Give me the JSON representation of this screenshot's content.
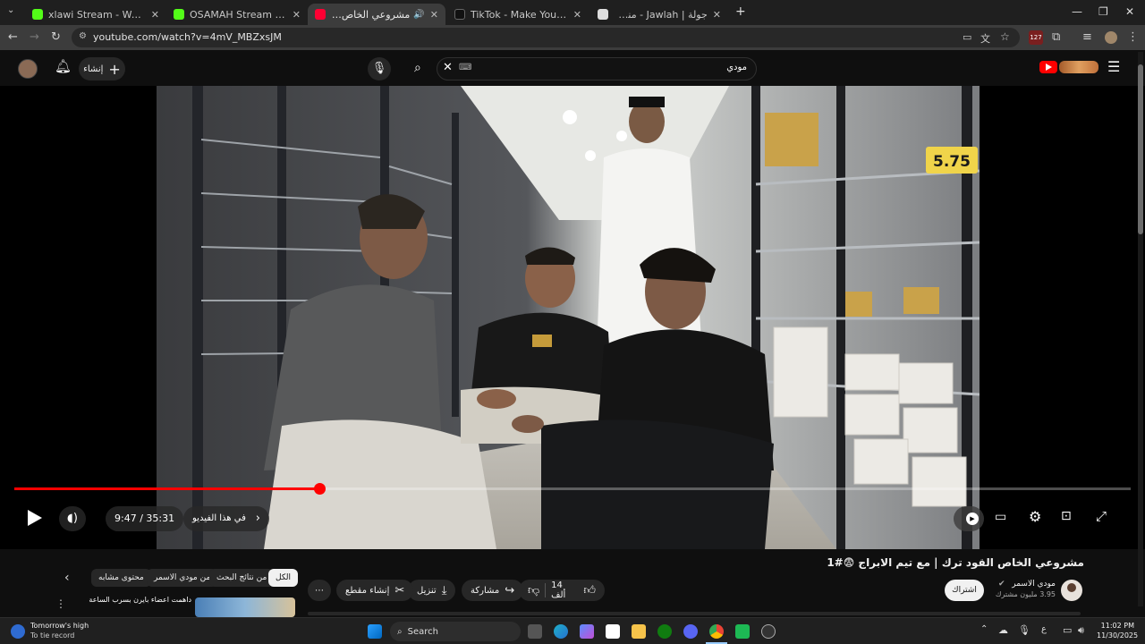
{
  "browser": {
    "tabs": [
      {
        "title": "xlawi Stream - Watch Live on K",
        "favicon": "kick-icon",
        "color": "#53fc18"
      },
      {
        "title": "OSAMAH Stream - Watch Live",
        "favicon": "kick-icon",
        "color": "#53fc18"
      },
      {
        "title": "مشروعي الخاص القود ترك |",
        "favicon": "youtube-icon",
        "color": "#ff0033",
        "active": true
      },
      {
        "title": "TikTok - Make Your Day",
        "favicon": "tiktok-icon",
        "color": "#ffffff"
      },
      {
        "title": "جولة | Jawlah - منصة الألعاب الـ",
        "favicon": "jawlah-icon",
        "color": "#dddddd"
      }
    ],
    "url": "youtube.com/watch?v=4mV_MBZxsJM",
    "extension_badge": "127"
  },
  "yt": {
    "create_label": "إنشاء",
    "search_value": "مودي",
    "search_kbd": "⌨"
  },
  "player": {
    "time": "9:47 / 35:31",
    "chapter": "في هذا الفيديو",
    "progress": 0.273,
    "price_sign": "5.75"
  },
  "video": {
    "title": "مشروعي الخاص القود ترك | مع تيم الابراج 😨#1",
    "channel": "مودي الاسمر",
    "subs": "3.95 مليون مشترك",
    "subscribe_label": "اشتراك",
    "likes": "14 ألف",
    "share_label": "مشاركة",
    "download_label": "تنزيل",
    "clip_label": "إنشاء مقطع"
  },
  "chips": [
    "الكل",
    "من نتائج البحث",
    "من مودي الاسمر",
    "محتوى مشابه"
  ],
  "related": {
    "title": "داهمت اعضاء بايرن بسرب الساعة !!",
    "channel": "Ibrahim L..."
  },
  "taskbar": {
    "notif_title": "Tomorrow's high",
    "notif_sub": "To tie record",
    "search_label": "Search",
    "lang": "ع",
    "time": "11:02 PM",
    "date": "11/30/2025"
  }
}
